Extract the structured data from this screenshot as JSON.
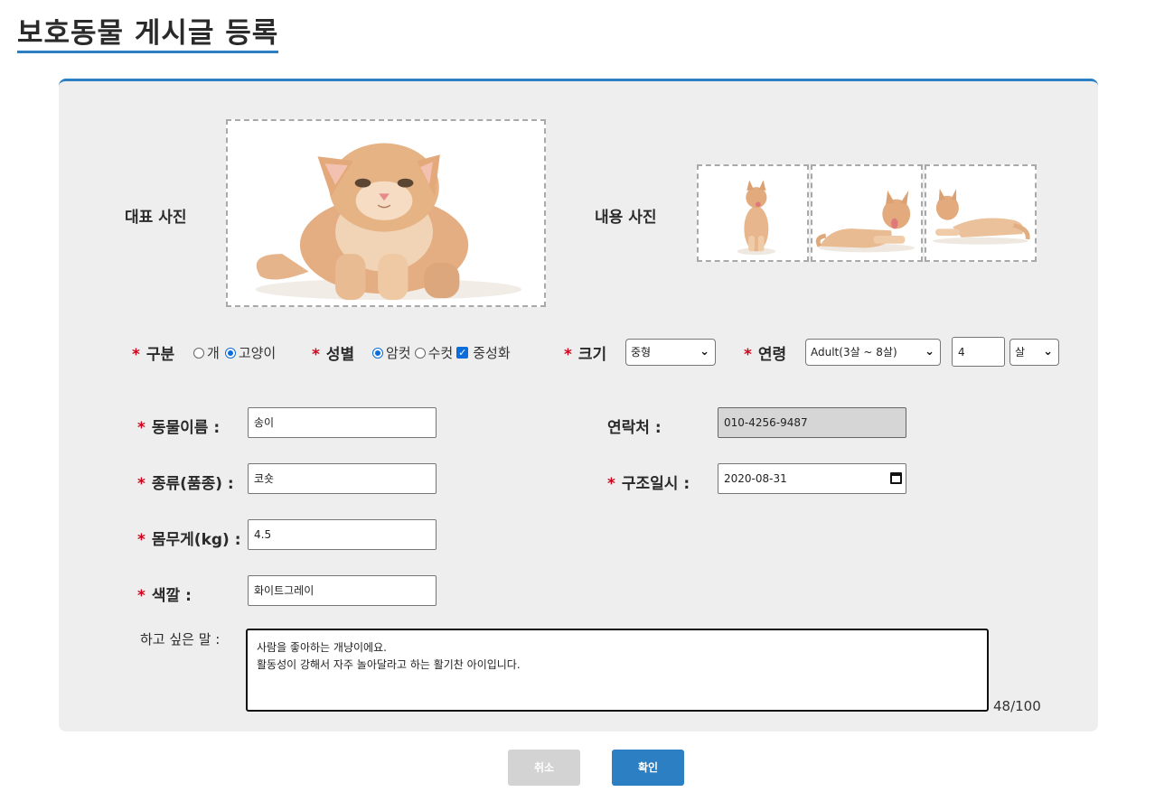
{
  "page": {
    "title": "보호동물 게시글 등록"
  },
  "photos": {
    "main_label": "대표 사진",
    "content_label": "내용 사진"
  },
  "fields": {
    "required_mark": "*",
    "type": {
      "label": "구분",
      "options": [
        "개",
        "고양이"
      ],
      "selected": "고양이"
    },
    "gender": {
      "label": "성별",
      "options": [
        "암컷",
        "수컷"
      ],
      "selected": "암컷",
      "neutered_label": "중성화",
      "neutered": true
    },
    "size": {
      "label": "크기",
      "value": "중형"
    },
    "age": {
      "label": "연령",
      "range_value": "Adult(3살 ~ 8살)",
      "number": "4",
      "unit": "살"
    },
    "name": {
      "label": "동물이름 :",
      "value": "송이"
    },
    "contact": {
      "label": "연락처 :",
      "value": "010-4256-9487"
    },
    "breed": {
      "label": "종류(품종) :",
      "value": "코숏"
    },
    "rescue_date": {
      "label": "구조일시 :",
      "value": "2020-08-31"
    },
    "weight": {
      "label": "몸무게(kg) :",
      "value": "4.5"
    },
    "color": {
      "label": "색깔 :",
      "value": "화이트그레이"
    },
    "message": {
      "label": "하고 싶은 말 :",
      "lines": [
        "사람을 좋아하는 개냥이에요.",
        "활동성이 강해서 자주 놀아달라고 하는 활기찬 아이입니다."
      ],
      "counter": "48/100"
    }
  },
  "buttons": {
    "cancel": "취소",
    "confirm": "확인"
  },
  "colors": {
    "accent": "#2b7fc2",
    "required": "#d0021b",
    "panel": "#eeeeee"
  }
}
